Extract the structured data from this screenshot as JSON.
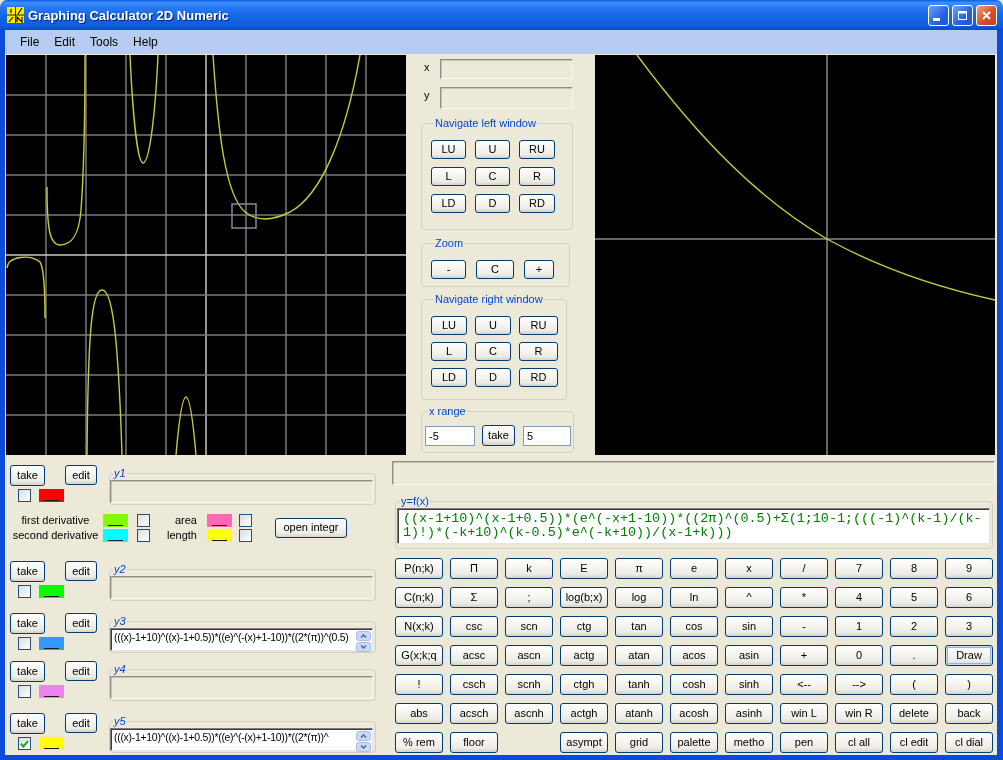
{
  "window": {
    "title": "Graphing Calculator 2D Numeric"
  },
  "menu": [
    "File",
    "Edit",
    "Tools",
    "Help"
  ],
  "coordinates": [
    {
      "label": "x"
    },
    {
      "label": "y"
    }
  ],
  "navigate_left": {
    "title": "Navigate left window",
    "buttons": [
      "LU",
      "U",
      "RU",
      "L",
      "C",
      "R",
      "LD",
      "D",
      "RD"
    ]
  },
  "zoom": {
    "title": "Zoom",
    "buttons": [
      "-",
      "C",
      "+"
    ]
  },
  "navigate_right": {
    "title": "Navigate right window",
    "buttons": [
      "LU",
      "U",
      "RU",
      "L",
      "C",
      "R",
      "LD",
      "D",
      "RD"
    ]
  },
  "x_range": {
    "title": "x range",
    "from": "-5",
    "button": "take",
    "to": "5"
  },
  "functions": [
    {
      "label": "y1",
      "take": "take",
      "edit": "edit",
      "checked": false,
      "color": "#ff0000"
    },
    {
      "label": "y2",
      "take": "take",
      "edit": "edit",
      "checked": false,
      "color": "#00ff00"
    },
    {
      "label": "y3",
      "take": "take",
      "edit": "edit",
      "checked": false,
      "color": "#3399ff",
      "value": "(((x)-1+10)^((x)-1+0.5))*((e)^(-(x)+1-10))*((2*(π))^(0.5)"
    },
    {
      "label": "y4",
      "take": "take",
      "edit": "edit",
      "checked": false,
      "color": "#ee82ee"
    },
    {
      "label": "y5",
      "take": "take",
      "edit": "edit",
      "checked": true,
      "color": "#ffff00",
      "value": "(((x)-1+10)^((x)-1+0.5))*((e)^(-(x)+1-10))*((2*(π))^"
    }
  ],
  "analysis": {
    "derivatives": [
      {
        "label": "first derivative",
        "color": "#80ff00",
        "checked": false
      },
      {
        "label": "second derivative",
        "color": "#00ffff",
        "checked": false
      }
    ],
    "integrals": [
      {
        "label": "area",
        "color": "#ff69b4",
        "checked": false
      },
      {
        "label": "length",
        "color": "#ffff00",
        "checked": false
      }
    ],
    "button": "open integr"
  },
  "formula": {
    "title": "y=f(x)",
    "value": "((x-1+10)^(x-1+0.5))*(e^(-x+1-10))*((2π)^(0.5)+Σ(1;10-1;(((-1)^(k-1)/(k-1)!)*(-k+10)^(k-0.5)*e^(-k+10))/(x-1+k)))"
  },
  "keypad": {
    "rows": [
      [
        {
          "kind": "key",
          "label": "P(n;k)",
          "focused": false
        },
        {
          "kind": "key",
          "label": "Π",
          "focused": false
        },
        {
          "kind": "key",
          "label": "k",
          "focused": false
        },
        {
          "kind": "key",
          "label": "E",
          "focused": false
        },
        {
          "kind": "key",
          "label": "π",
          "focused": false
        },
        {
          "kind": "key",
          "label": "e",
          "focused": false
        },
        {
          "kind": "key",
          "label": "x",
          "focused": false
        },
        {
          "kind": "key",
          "label": "/",
          "focused": false
        },
        {
          "kind": "key",
          "label": "7",
          "focused": false
        },
        {
          "kind": "key",
          "label": "8",
          "focused": false
        },
        {
          "kind": "key",
          "label": "9",
          "focused": false
        }
      ],
      [
        {
          "kind": "key",
          "label": "C(n;k)",
          "focused": false
        },
        {
          "kind": "key",
          "label": "Σ",
          "focused": false
        },
        {
          "kind": "key",
          "label": ";",
          "focused": false
        },
        {
          "kind": "key",
          "label": "log(b;x)",
          "focused": false
        },
        {
          "kind": "key",
          "label": "log",
          "focused": false
        },
        {
          "kind": "key",
          "label": "ln",
          "focused": false
        },
        {
          "kind": "key",
          "label": "^",
          "focused": false
        },
        {
          "kind": "key",
          "label": "*",
          "focused": false
        },
        {
          "kind": "key",
          "label": "4",
          "focused": false
        },
        {
          "kind": "key",
          "label": "5",
          "focused": false
        },
        {
          "kind": "key",
          "label": "6",
          "focused": false
        }
      ],
      [
        {
          "kind": "key",
          "label": "N(x;k)",
          "focused": false
        },
        {
          "kind": "key",
          "label": "csc",
          "focused": false
        },
        {
          "kind": "key",
          "label": "scn",
          "focused": false
        },
        {
          "kind": "key",
          "label": "ctg",
          "focused": false
        },
        {
          "kind": "key",
          "label": "tan",
          "focused": false
        },
        {
          "kind": "key",
          "label": "cos",
          "focused": false
        },
        {
          "kind": "key",
          "label": "sin",
          "focused": false
        },
        {
          "kind": "key",
          "label": "-",
          "focused": false
        },
        {
          "kind": "key",
          "label": "1",
          "focused": false
        },
        {
          "kind": "key",
          "label": "2",
          "focused": false
        },
        {
          "kind": "key",
          "label": "3",
          "focused": false
        }
      ],
      [
        {
          "kind": "key",
          "label": "G(x;k;q",
          "focused": false
        },
        {
          "kind": "key",
          "label": "acsc",
          "focused": false
        },
        {
          "kind": "key",
          "label": "ascn",
          "focused": false
        },
        {
          "kind": "key",
          "label": "actg",
          "focused": false
        },
        {
          "kind": "key",
          "label": "atan",
          "focused": false
        },
        {
          "kind": "key",
          "label": "acos",
          "focused": false
        },
        {
          "kind": "key",
          "label": "asin",
          "focused": false
        },
        {
          "kind": "key",
          "label": "+",
          "focused": false
        },
        {
          "kind": "key",
          "label": "0",
          "focused": false
        },
        {
          "kind": "key",
          "label": ".",
          "focused": false
        },
        {
          "kind": "key",
          "label": "Draw",
          "focused": true
        }
      ],
      [
        {
          "kind": "key",
          "label": "!",
          "focused": false
        },
        {
          "kind": "key",
          "label": "csch",
          "focused": false
        },
        {
          "kind": "key",
          "label": "scnh",
          "focused": false
        },
        {
          "kind": "key",
          "label": "ctgh",
          "focused": false
        },
        {
          "kind": "key",
          "label": "tanh",
          "focused": false
        },
        {
          "kind": "key",
          "label": "cosh",
          "focused": false
        },
        {
          "kind": "key",
          "label": "sinh",
          "focused": false
        },
        {
          "kind": "key",
          "label": "<--",
          "focused": false
        },
        {
          "kind": "key",
          "label": "-->",
          "focused": false
        },
        {
          "kind": "key",
          "label": "(",
          "focused": false
        },
        {
          "kind": "key",
          "label": ")",
          "focused": false
        }
      ],
      [
        {
          "kind": "key",
          "label": "abs",
          "focused": false
        },
        {
          "kind": "key",
          "label": "acsch",
          "focused": false
        },
        {
          "kind": "key",
          "label": "ascnh",
          "focused": false
        },
        {
          "kind": "key",
          "label": "actgh",
          "focused": false
        },
        {
          "kind": "key",
          "label": "atanh",
          "focused": false
        },
        {
          "kind": "key",
          "label": "acosh",
          "focused": false
        },
        {
          "kind": "key",
          "label": "asinh",
          "focused": false
        },
        {
          "kind": "key",
          "label": "win L",
          "focused": false
        },
        {
          "kind": "key",
          "label": "win R",
          "focused": false
        },
        {
          "kind": "key",
          "label": "delete",
          "focused": false
        },
        {
          "kind": "key",
          "label": "back",
          "focused": false
        }
      ],
      [
        {
          "kind": "key",
          "label": "% rem",
          "focused": false
        },
        {
          "kind": "key",
          "label": "floor",
          "focused": false
        },
        {
          "kind": "gap"
        },
        {
          "kind": "key",
          "label": "asympt",
          "focused": false
        },
        {
          "kind": "key",
          "label": "grid",
          "focused": false
        },
        {
          "kind": "key",
          "label": "palette",
          "focused": false
        },
        {
          "kind": "key",
          "label": "metho",
          "focused": false
        },
        {
          "kind": "key",
          "label": "pen",
          "focused": false
        },
        {
          "kind": "key",
          "label": "cl all",
          "focused": false
        },
        {
          "kind": "key",
          "label": "cl edit",
          "focused": false
        },
        {
          "kind": "key",
          "label": "cl dial",
          "focused": false
        }
      ]
    ]
  }
}
